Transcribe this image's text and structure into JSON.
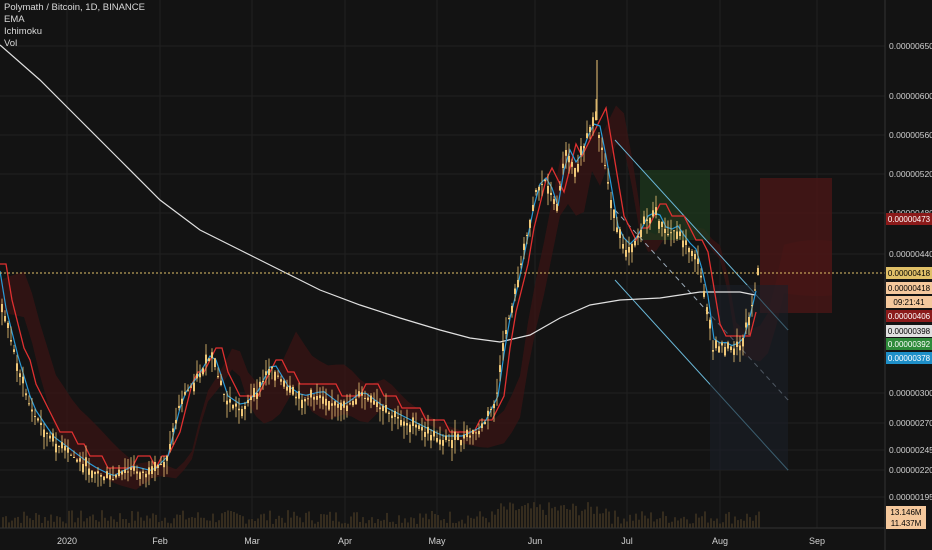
{
  "legend": {
    "title": "Polymath / Bitcoin, 1D, BINANCE",
    "indicators": [
      "EMA",
      "Ichimoku",
      "Vol"
    ]
  },
  "chart_data": {
    "type": "candlestick",
    "symbol": "Polymath / Bitcoin",
    "interval": "1D",
    "exchange": "BINANCE",
    "x_ticks": [
      "2020",
      "Feb",
      "Mar",
      "Apr",
      "May",
      "Jun",
      "Jul",
      "Aug",
      "Sep"
    ],
    "y_ticks": [
      "0.00000650",
      "0.00000600",
      "0.00000560",
      "0.00000520",
      "0.00000480",
      "0.00000440",
      "0.00000300",
      "0.00000270",
      "0.00000245",
      "0.00000220",
      "0.00000195"
    ],
    "price_line": 4.18e-06,
    "price_labels": [
      {
        "text": "0.00000473",
        "color": "#8b1a1a",
        "text_color": "#ffffff"
      },
      {
        "text": "0.00000418",
        "color": "#e0c068",
        "text_color": "#000000"
      },
      {
        "text": "0.00000418",
        "color": "#f5c89c",
        "text_color": "#000000"
      },
      {
        "text": "09:21:41",
        "color": "#f5c89c",
        "text_color": "#000000"
      },
      {
        "text": "0.00000406",
        "color": "#8b1a1a",
        "text_color": "#ffffff"
      },
      {
        "text": "0.00000398",
        "color": "#e0e0e0",
        "text_color": "#000000"
      },
      {
        "text": "0.00000392",
        "color": "#2e8b3a",
        "text_color": "#ffffff"
      },
      {
        "text": "0.00000378",
        "color": "#1e8fc8",
        "text_color": "#ffffff"
      }
    ],
    "volume_labels": [
      {
        "text": "13.146M",
        "color": "#f5c89c",
        "text_color": "#000000"
      },
      {
        "text": "11.437M",
        "color": "#f5c89c",
        "text_color": "#000000"
      }
    ],
    "close_approx": [
      3.2e-06,
      2.8e-06,
      2.5e-06,
      2.1e-06,
      2.2e-06,
      2.5e-06,
      3.2e-06,
      3.4e-06,
      3.1e-06,
      3.3e-06,
      2.9e-06,
      3.1e-06,
      3e-06,
      2.9e-06,
      2.7e-06,
      2.6e-06,
      2.5e-06,
      2.7e-06,
      3.2e-06,
      4.5e-06,
      5.3e-06,
      5.7e-06,
      4.6e-06,
      5.2e-06,
      5.8e-06,
      5.1e-06,
      4.8e-06,
      4.9e-06,
      4.7e-06,
      4.6e-06,
      3.6e-06,
      3.9e-06,
      4.2e-06
    ],
    "colors": {
      "background": "#131313",
      "candle": "#f0c878",
      "ema": "#e0e0e0",
      "kijun": "#e03030",
      "tenkan": "#2a9ad8",
      "cloud_green": "#1e3a1e",
      "cloud_red": "#3a1414",
      "channel": "#6ab8d8",
      "price_line": "#e0c068"
    }
  }
}
